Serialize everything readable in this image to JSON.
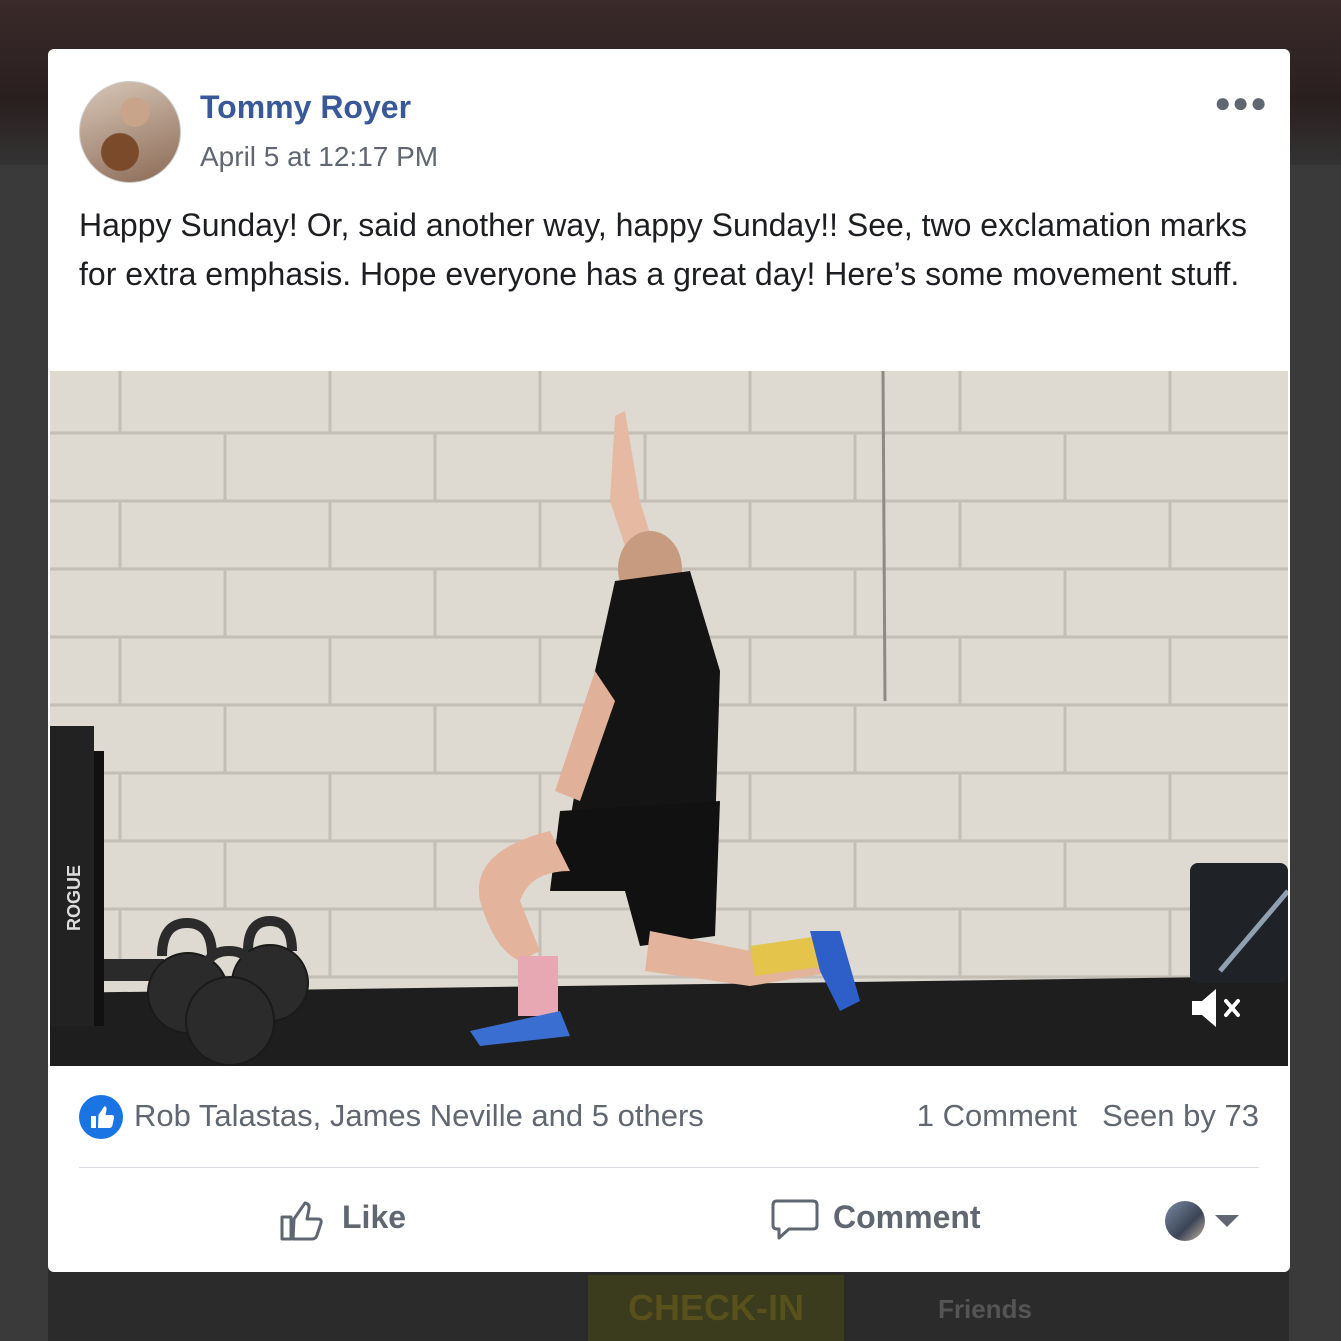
{
  "post": {
    "author": "Tommy Royer",
    "timestamp": "April 5 at 12:17 PM",
    "more_icon": "more-options-icon",
    "text": "Happy Sunday! Or, said another way, happy Sunday!! See, two exclamation marks for extra emphasis. Hope everyone has a great day! Here’s some movement stuff."
  },
  "video": {
    "equipment_label": "ROGUE",
    "muted": true,
    "mute_icon": "speaker-muted-icon"
  },
  "reactions": {
    "likers": "Rob Talastas, James Neville and 5 others",
    "comments": "1 Comment",
    "seen_by": "Seen by 73",
    "icon": "thumbs-up-icon"
  },
  "actions": {
    "like_label": "Like",
    "comment_label": "Comment",
    "like_icon": "thumbs-up-outline-icon",
    "comment_icon": "speech-bubble-icon",
    "selector_icon": "caret-down-icon"
  },
  "background": {
    "friends_label": "Friends",
    "checkin_label": "CHECK-IN"
  },
  "colors": {
    "author_link": "#385898",
    "like_badge": "#1b74e4",
    "secondary_text": "#616770"
  }
}
